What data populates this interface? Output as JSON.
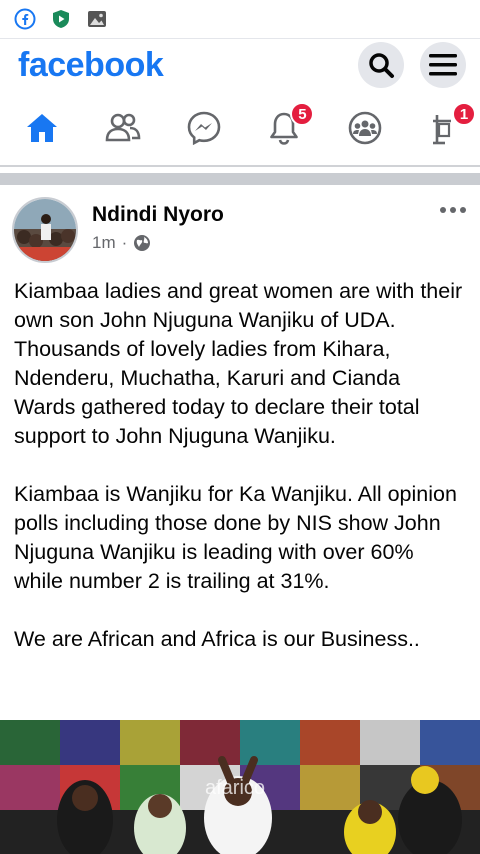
{
  "status_bar": {
    "icons": [
      "facebook-icon",
      "shield-play-icon",
      "image-icon"
    ]
  },
  "header": {
    "logo": "facebook",
    "actions": [
      "search-icon",
      "menu-icon"
    ]
  },
  "tabs": [
    {
      "name": "home",
      "icon": "home-icon"
    },
    {
      "name": "friends",
      "icon": "friends-icon"
    },
    {
      "name": "messenger",
      "icon": "messenger-icon"
    },
    {
      "name": "notifications",
      "icon": "bell-icon",
      "badge": "5"
    },
    {
      "name": "groups",
      "icon": "groups-icon"
    },
    {
      "name": "marketplace",
      "icon": "marketplace-icon",
      "badge": "1"
    }
  ],
  "post": {
    "author": "Ndindi Nyoro",
    "time": "1m",
    "separator": "·",
    "privacy_icon": "globe-icon",
    "paragraphs": [
      "Kiambaa ladies and great women are with their own son John Njuguna Wanjiku of UDA. Thousands of lovely ladies from Kihara, Ndenderu, Muchatha, Karuri and Cianda Wards gathered today to declare their total support to John Njuguna Wanjiku.",
      "Kiambaa is Wanjiku for Ka Wanjiku. All opinion polls including those done by NIS show John Njuguna Wanjiku is leading with over 60% while number 2 is trailing at 31%.",
      "We are African and Africa is our Business.."
    ],
    "image_watermark": "afarico"
  },
  "colors": {
    "brand": "#1877f2",
    "badge": "#e41e3f"
  }
}
